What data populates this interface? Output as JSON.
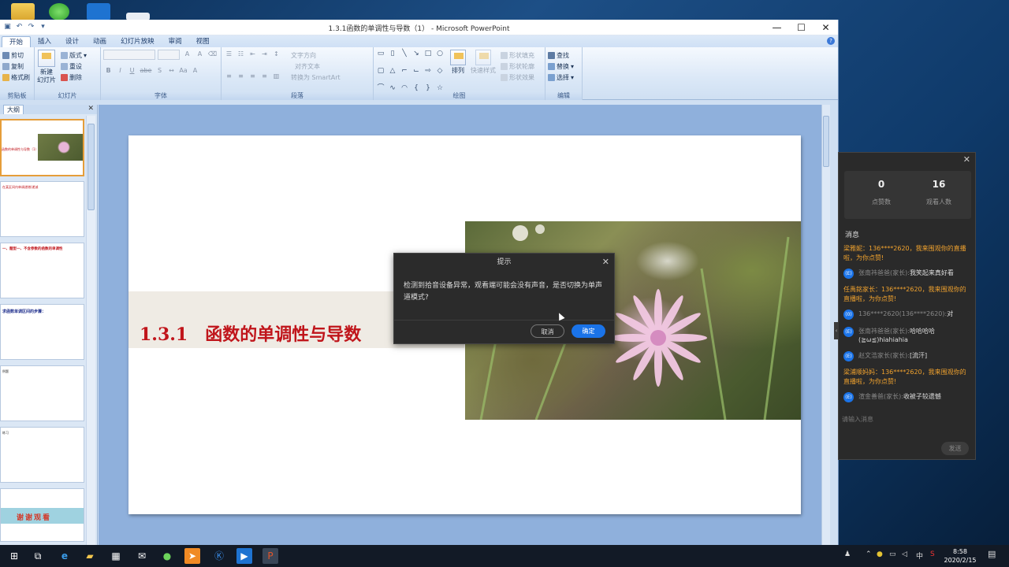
{
  "window": {
    "title": "1.3.1函数的单调性与导数（1） - Microsoft PowerPoint",
    "minimize": "—",
    "maximize": "☐",
    "close": "✕"
  },
  "ribbon": {
    "tabs": [
      "开始",
      "插入",
      "设计",
      "动画",
      "幻灯片放映",
      "审阅",
      "视图"
    ],
    "clipboard": {
      "cut": "剪切",
      "copy": "复制",
      "format_painter": "格式刷",
      "label": "剪贴板"
    },
    "slides": {
      "new_slide": "新建\n幻灯片",
      "layout": "版式",
      "reset": "重设",
      "delete": "删除",
      "label": "幻灯片"
    },
    "font": {
      "label": "字体",
      "bold": "B",
      "italic": "I",
      "underline": "U",
      "strike": "abe",
      "shadow": "S"
    },
    "paragraph": {
      "text_direction": "文字方向",
      "align_text": "对齐文本",
      "smartart": "转换为 SmartArt",
      "label": "段落"
    },
    "drawing": {
      "arrange": "排列",
      "quick_styles": "快速样式",
      "shape_fill": "形状填充",
      "shape_outline": "形状轮廓",
      "shape_effects": "形状效果",
      "label": "绘图"
    },
    "editing": {
      "find": "查找",
      "replace": "替换",
      "select": "选择",
      "label": "编辑"
    }
  },
  "left_pane": {
    "tab_label": "大纲",
    "close": "✕",
    "thumbnails": [
      {
        "text": "函数的单调性与导数（1）"
      },
      {
        "text": "在某区间内单调递增/递减"
      },
      {
        "text": "一、题型一、不含参数的函数的单调性"
      },
      {
        "text": "求函数单调区间的步骤："
      },
      {
        "text": "例题"
      },
      {
        "text": "练习"
      },
      {
        "text": "谢谢观看"
      }
    ]
  },
  "slide": {
    "title": "1.3.1　函数的单调性与导数"
  },
  "dialog": {
    "title": "提示",
    "message": "检测到拾音设备异常，观看端可能会没有声音，是否切换为单声道模式?",
    "cancel": "取消",
    "ok": "确定",
    "close": "✕"
  },
  "live_panel": {
    "close": "✕",
    "likes": "0",
    "likes_label": "点赞数",
    "viewers": "16",
    "viewers_label": "观看人数",
    "messages_header": "消息",
    "messages": [
      {
        "kind": "system",
        "text": "梁雅妮：136****2620，我来围观你的直播啦，为你点赞!"
      },
      {
        "kind": "user",
        "avatar": "(E)",
        "name": "张南祎爸爸(家长):",
        "text": "我笑起来真好看"
      },
      {
        "kind": "system",
        "text": "任禹銘家长：136****2620，我来围观你的直播啦，为你点赞!"
      },
      {
        "kind": "user",
        "avatar": "(0)",
        "name": "136****2620(136****2620):",
        "text": "对"
      },
      {
        "kind": "user",
        "avatar": "(E)",
        "name": "张南祎爸爸(家长):",
        "text": "哈哈哈哈(≧ω≦)hiahiahia"
      },
      {
        "kind": "user",
        "avatar": "(E)",
        "name": "赵文浩家长(家长):",
        "text": "[流汗]"
      },
      {
        "kind": "system",
        "text": "梁浦顺妈妈：136****2620，我来围观你的直播啦，为你点赞!"
      },
      {
        "kind": "user",
        "avatar": "(E)",
        "name": "渲金善爸(家长):",
        "text": "收被子较遗憾"
      }
    ],
    "input_placeholder": "请输入消息",
    "send": "发送",
    "collapse": "‹"
  },
  "taskbar": {
    "clock_time": "8:58",
    "clock_date": "2020/2/15",
    "ime": "中"
  }
}
